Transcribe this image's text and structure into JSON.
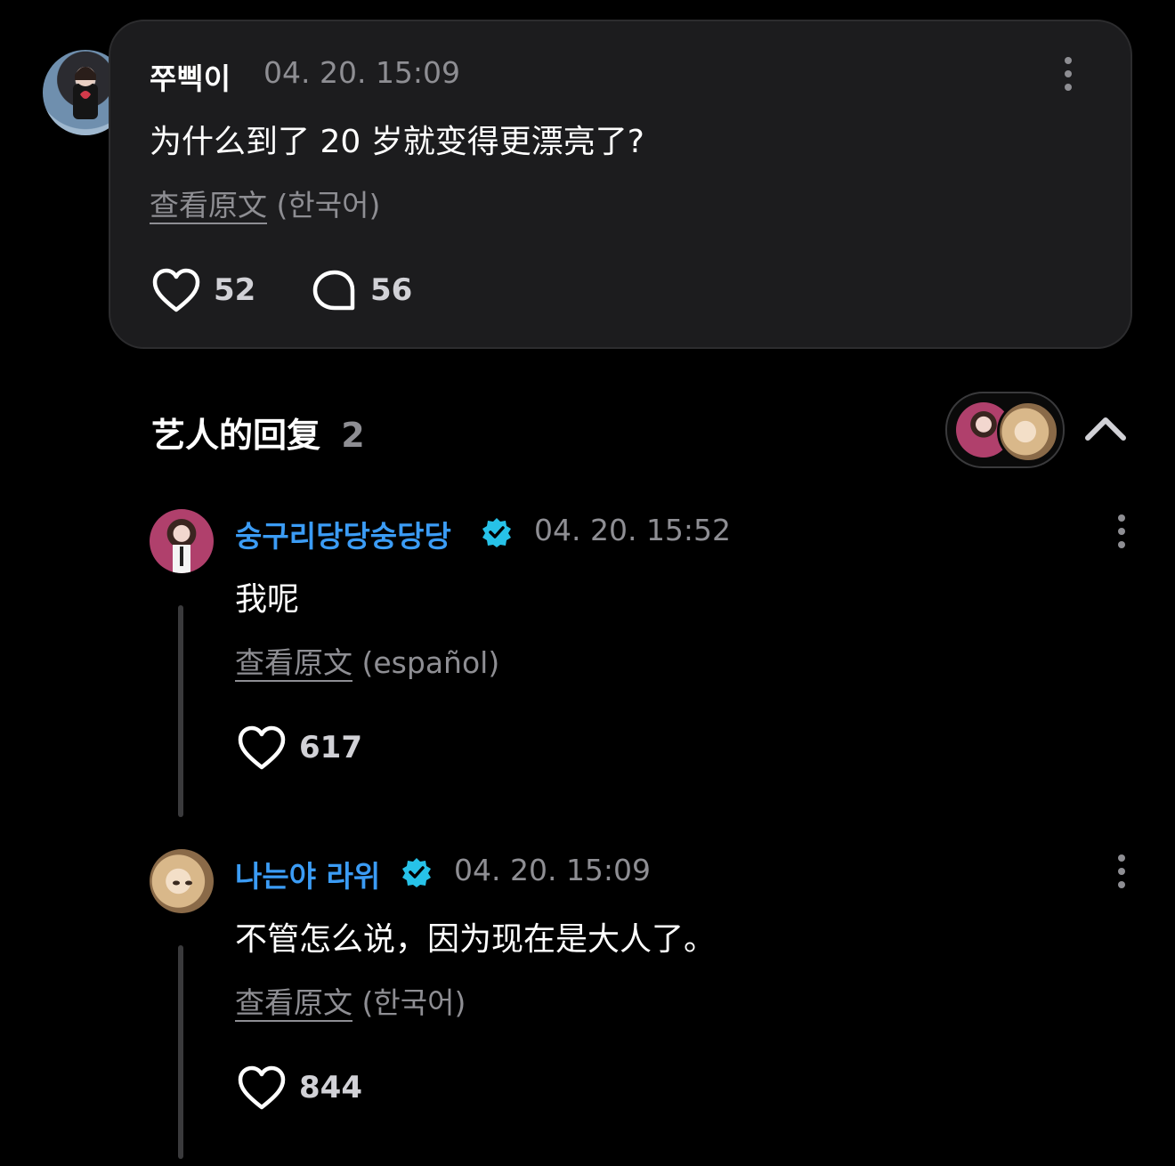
{
  "post": {
    "author": "쭈삑이",
    "time": "04. 20. 15:09",
    "text": "为什么到了 20 岁就变得更漂亮了?",
    "translate_link": "查看原文",
    "translate_lang": "(한국어)",
    "likes": "52",
    "comments": "56"
  },
  "replies_header": {
    "title": "艺人的回复",
    "count": "2"
  },
  "replies": [
    {
      "author": "숭구리당당숭당당",
      "time": "04. 20. 15:52",
      "text": "我呢",
      "translate_link": "查看原文",
      "translate_lang": "(español)",
      "likes": "617"
    },
    {
      "author": "나는야 라위",
      "time": "04. 20. 15:09",
      "text": "不管怎么说，因为现在是大人了。",
      "translate_link": "查看原文",
      "translate_lang": "(한국어)",
      "likes": "844"
    }
  ],
  "colors": {
    "background": "#000000",
    "card": "#1c1c1e",
    "artist_name": "#3b9cf5",
    "verified_badge": "#27c2e8",
    "muted": "#8e8e93"
  }
}
